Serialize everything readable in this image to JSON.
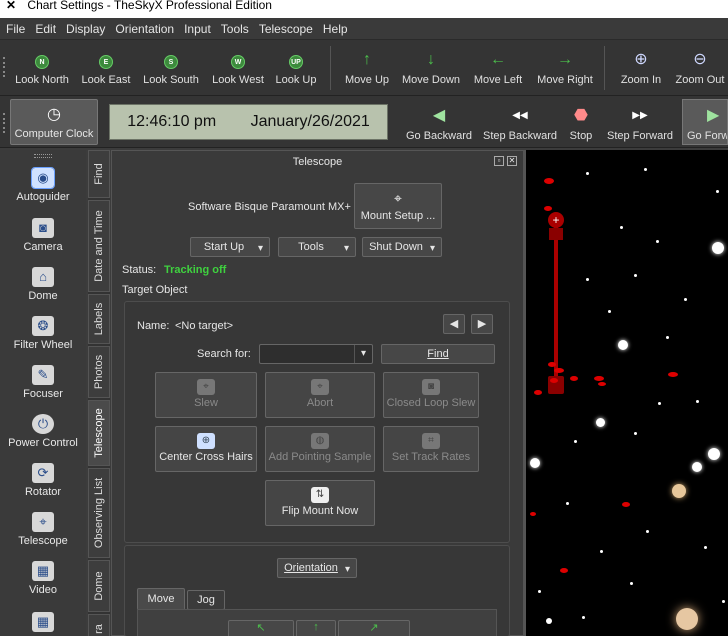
{
  "window": {
    "title": "Chart Settings - TheSkyX Professional Edition"
  },
  "menu": [
    "File",
    "Edit",
    "Display",
    "Orientation",
    "Input",
    "Tools",
    "Telescope",
    "Help"
  ],
  "toolbar1": [
    {
      "label": "Look North",
      "glyph": "N"
    },
    {
      "label": "Look East",
      "glyph": "E"
    },
    {
      "label": "Look South",
      "glyph": "S"
    },
    {
      "label": "Look West",
      "glyph": "W"
    },
    {
      "label": "Look Up",
      "glyph": "UP"
    },
    {
      "label": "Move Up",
      "glyph": "↑"
    },
    {
      "label": "Move Down",
      "glyph": "↓"
    },
    {
      "label": "Move Left",
      "glyph": "←"
    },
    {
      "label": "Move Right",
      "glyph": "→"
    },
    {
      "label": "Zoom In",
      "glyph": "⊕"
    },
    {
      "label": "Zoom Out",
      "glyph": "⊖"
    }
  ],
  "toolbar2": {
    "computer_clock": "Computer Clock",
    "time": "12:46:10 pm",
    "date": "January/26/2021",
    "buttons": [
      {
        "label": "Go Backward",
        "glyph": "◀"
      },
      {
        "label": "Step Backward",
        "glyph": "◀◀"
      },
      {
        "label": "Stop",
        "glyph": "⬣"
      },
      {
        "label": "Step Forward",
        "glyph": "▶▶"
      },
      {
        "label": "Go Forw",
        "glyph": "▶"
      }
    ]
  },
  "sidebar": [
    {
      "label": "Autoguider",
      "glyph": "◉"
    },
    {
      "label": "Camera",
      "glyph": "◙"
    },
    {
      "label": "Dome",
      "glyph": "⌂"
    },
    {
      "label": "Filter Wheel",
      "glyph": "❂"
    },
    {
      "label": "Focuser",
      "glyph": "✎"
    },
    {
      "label": "Power Control",
      "glyph": "⏻"
    },
    {
      "label": "Rotator",
      "glyph": "⟳"
    },
    {
      "label": "Telescope",
      "glyph": "⌖"
    },
    {
      "label": "Video",
      "glyph": "▦"
    },
    {
      "label": "",
      "glyph": "▦"
    }
  ],
  "vtabs": [
    "Find",
    "Date and Time",
    "Labels",
    "Photos",
    "Telescope",
    "Observing List",
    "Dome",
    "ra"
  ],
  "panel": {
    "title": "Telescope",
    "mount_name": "Software Bisque Paramount MX+",
    "mount_setup": "Mount Setup ...",
    "start_up": "Start Up",
    "tools": "Tools",
    "shut_down": "Shut Down",
    "status_label": "Status:",
    "status_value": "Tracking off",
    "target_object": "Target Object",
    "name_label": "Name:",
    "name_value": "<No target>",
    "search_label": "Search for:",
    "search_value": "",
    "find": "Find",
    "slew": "Slew",
    "abort": "Abort",
    "closed_loop": "Closed Loop Slew",
    "center": "Center Cross Hairs",
    "add_pointing": "Add Pointing Sample",
    "set_track": "Set Track Rates",
    "flip": "Flip Mount Now",
    "orientation": "Orientation",
    "tab_move": "Move",
    "tab_jog": "Jog"
  },
  "colors": {
    "status": "#3fd13f",
    "sky": "#000000",
    "lcd": "#b8c2ad"
  }
}
